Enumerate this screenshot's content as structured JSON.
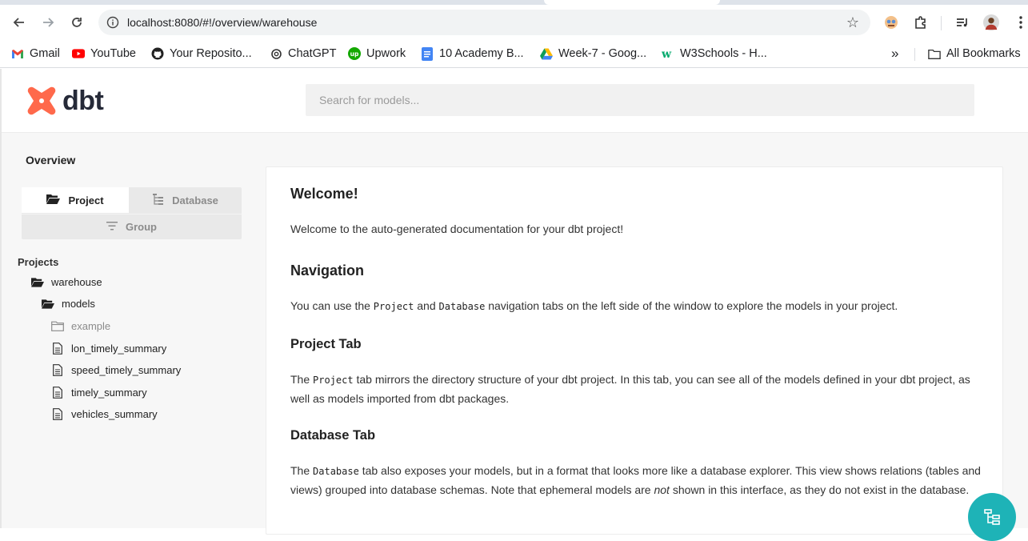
{
  "browser": {
    "url": "localhost:8080/#!/overview/warehouse",
    "bookmarks": [
      {
        "label": "Gmail",
        "icon": "gmail-icon"
      },
      {
        "label": "YouTube",
        "icon": "youtube-icon"
      },
      {
        "label": "Your Reposito...",
        "icon": "github-icon"
      },
      {
        "label": "ChatGPT",
        "icon": "chatgpt-icon"
      },
      {
        "label": "Upwork",
        "icon": "upwork-icon"
      },
      {
        "label": "10 Academy B...",
        "icon": "google-docs-icon"
      },
      {
        "label": "Week-7 - Goog...",
        "icon": "google-drive-icon"
      },
      {
        "label": "W3Schools - H...",
        "icon": "w3schools-icon"
      }
    ],
    "more_label": "»",
    "all_bookmarks_label": "All Bookmarks"
  },
  "app": {
    "logo_text": "dbt",
    "brand_color": "#ff694b",
    "search_placeholder": "Search for models..."
  },
  "sidebar": {
    "title": "Overview",
    "tabs": {
      "project": "Project",
      "database": "Database",
      "group": "Group"
    },
    "tree_heading": "Projects",
    "tree": [
      {
        "label": "warehouse",
        "icon": "folder-open-icon",
        "muted": false
      },
      {
        "label": "models",
        "icon": "folder-open-icon",
        "muted": false
      },
      {
        "label": "example",
        "icon": "folder-icon",
        "muted": true
      },
      {
        "label": "lon_timely_summary",
        "icon": "file-icon",
        "muted": false
      },
      {
        "label": "speed_timely_summary",
        "icon": "file-icon",
        "muted": false
      },
      {
        "label": "timely_summary",
        "icon": "file-icon",
        "muted": false
      },
      {
        "label": "vehicles_summary",
        "icon": "file-icon",
        "muted": false
      }
    ]
  },
  "content": {
    "welcome_title": "Welcome!",
    "welcome_text": "Welcome to the auto-generated documentation for your dbt project!",
    "navigation_title": "Navigation",
    "navigation_text": {
      "pre": "You can use the ",
      "code1": "Project",
      "mid": " and ",
      "code2": "Database",
      "post": " navigation tabs on the left side of the window to explore the models in your project."
    },
    "project_tab_title": "Project Tab",
    "project_tab_text": {
      "pre": "The ",
      "code": "Project",
      "post": " tab mirrors the directory structure of your dbt project. In this tab, you can see all of the models defined in your dbt project, as well as models imported from dbt packages."
    },
    "database_tab_title": "Database Tab",
    "database_tab_text": {
      "pre": "The ",
      "code": "Database",
      "mid": " tab also exposes your models, but in a format that looks more like a database explorer. This view shows relations (tables and views) grouped into database schemas. Note that ephemeral models are ",
      "em": "not",
      "post": " shown in this interface, as they do not exist in the database."
    }
  },
  "fab_color": "#1eb3b7"
}
